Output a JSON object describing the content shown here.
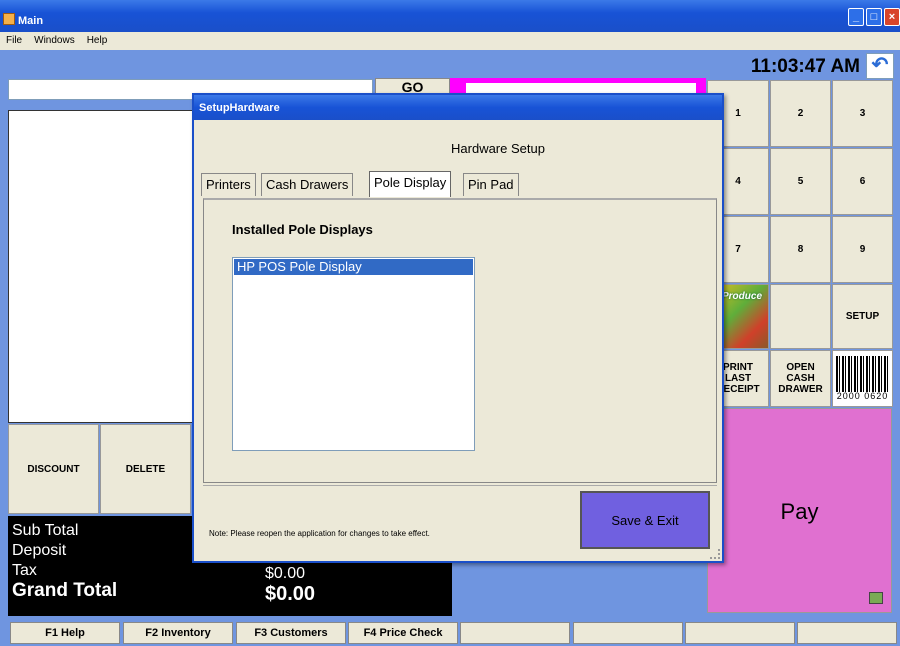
{
  "window": {
    "title": "Main"
  },
  "menu": [
    "File",
    "Windows",
    "Help"
  ],
  "clock": "11:03:47 AM",
  "go_label": "GO",
  "numpad": [
    "1",
    "2",
    "3",
    "4",
    "5",
    "6",
    "7",
    "8",
    "9"
  ],
  "tiles": {
    "produce_label": "Produce",
    "setup": "SETUP",
    "print_last_receipt": "PRINT LAST RECEIPT",
    "open_cash_drawer": "OPEN CASH DRAWER",
    "barcode_text": "2000 0620"
  },
  "actions": {
    "discount": "DISCOUNT",
    "delete": "DELETE"
  },
  "totals": {
    "sub_total_label": "Sub Total",
    "deposit_label": "Deposit",
    "tax_label": "Tax",
    "grand_total_label": "Grand Total",
    "tax_value": "$0.00",
    "grand_total_value": "$0.00"
  },
  "pay_label": "Pay",
  "function_keys": [
    "F1 Help",
    "F2 Inventory",
    "F3 Customers",
    "F4 Price Check",
    "",
    "",
    "",
    ""
  ],
  "dialog": {
    "title": "SetupHardware",
    "heading": "Hardware Setup",
    "tabs": [
      "Printers",
      "Cash Drawers",
      "Pole Display",
      "Pin Pad"
    ],
    "active_tab": "Pole Display",
    "installed_label": "Installed Pole Displays",
    "installed_items": [
      "HP POS Pole Display"
    ],
    "note": "Note: Please reopen the application for changes to take effect.",
    "save_exit": "Save & Exit"
  },
  "colors": {
    "accent_blue": "#6f95e0",
    "pay_pink": "#e070d0",
    "magenta": "#ff00ff",
    "save_purple": "#7060e0"
  }
}
